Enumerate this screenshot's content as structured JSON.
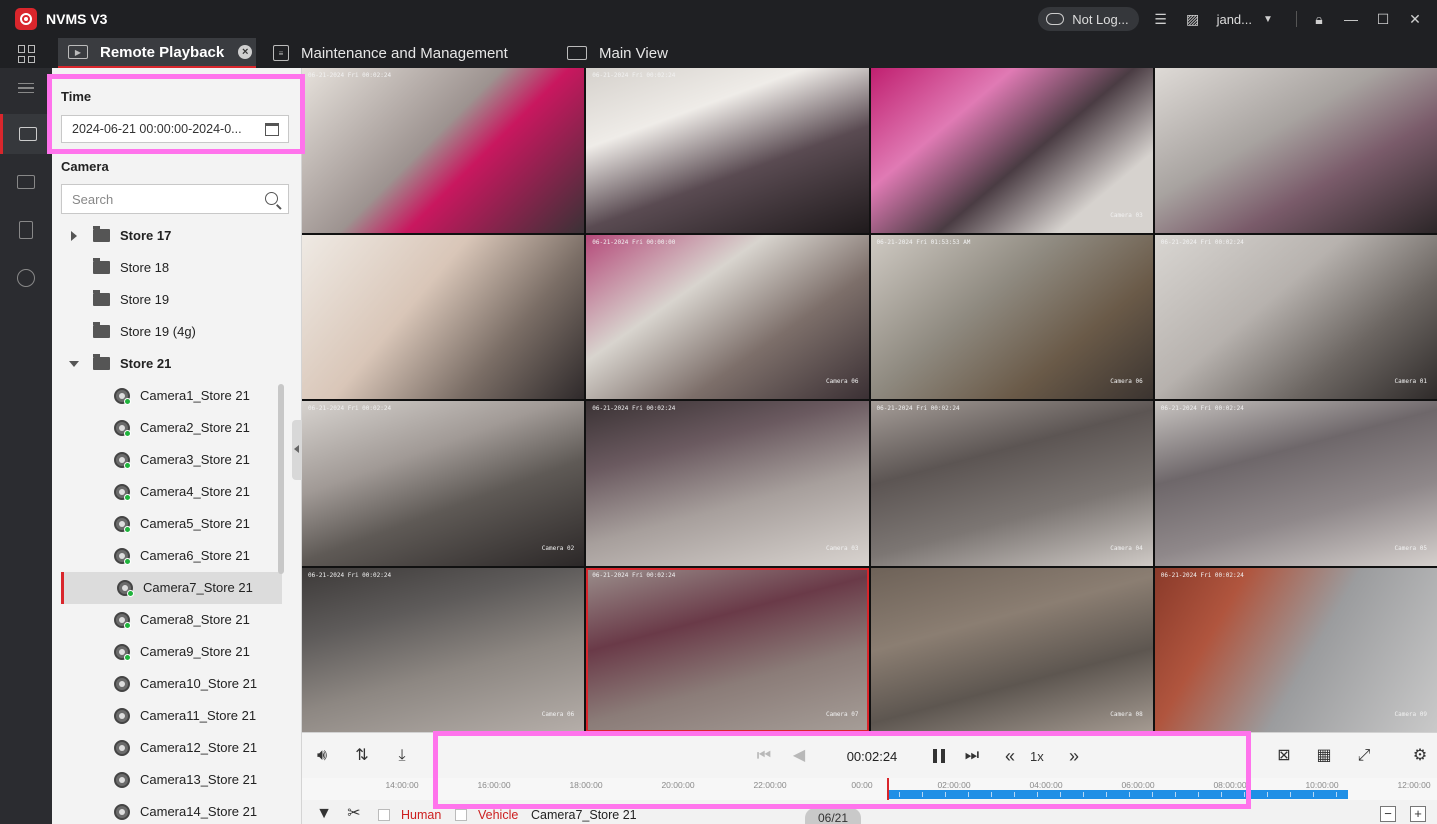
{
  "app": {
    "title": "NVMS V3"
  },
  "titlebar": {
    "login_status": "Not Log...",
    "user": "jand..."
  },
  "tabs": [
    {
      "label": "Remote Playback",
      "active": true,
      "closable": true
    },
    {
      "label": "Maintenance and Management",
      "active": false
    },
    {
      "label": "Main View",
      "active": false
    }
  ],
  "panel": {
    "time_label": "Time",
    "time_value": "2024-06-21 00:00:00-2024-0...",
    "camera_label": "Camera",
    "search_placeholder": "Search",
    "tree": [
      {
        "type": "group",
        "label": "Store 17",
        "state": "collapsed"
      },
      {
        "type": "group",
        "label": "Store 18"
      },
      {
        "type": "group",
        "label": "Store 19"
      },
      {
        "type": "group",
        "label": "Store 19 (4g)"
      },
      {
        "type": "group",
        "label": "Store 21",
        "state": "expanded"
      },
      {
        "type": "camera",
        "label": "Camera1_Store 21",
        "online": true
      },
      {
        "type": "camera",
        "label": "Camera2_Store 21",
        "online": true
      },
      {
        "type": "camera",
        "label": "Camera3_Store 21",
        "online": true
      },
      {
        "type": "camera",
        "label": "Camera4_Store 21",
        "online": true
      },
      {
        "type": "camera",
        "label": "Camera5_Store 21",
        "online": true
      },
      {
        "type": "camera",
        "label": "Camera6_Store 21",
        "online": true
      },
      {
        "type": "camera",
        "label": "Camera7_Store 21",
        "online": true,
        "selected": true
      },
      {
        "type": "camera",
        "label": "Camera8_Store 21",
        "online": true
      },
      {
        "type": "camera",
        "label": "Camera9_Store 21",
        "online": true
      },
      {
        "type": "camera",
        "label": "Camera10_Store 21",
        "online": false
      },
      {
        "type": "camera",
        "label": "Camera11_Store 21",
        "online": false
      },
      {
        "type": "camera",
        "label": "Camera12_Store 21",
        "online": false
      },
      {
        "type": "camera",
        "label": "Camera13_Store 21",
        "online": false
      },
      {
        "type": "camera",
        "label": "Camera14_Store 21",
        "online": false
      }
    ]
  },
  "video_tiles": [
    {
      "stamp": "06-21-2024 Fri 00:02:24",
      "tag": "",
      "style": "t-a"
    },
    {
      "stamp": "06-21-2024 Fri 00:02:24",
      "tag": "",
      "style": "t-b"
    },
    {
      "stamp": "",
      "tag": "Camera 03",
      "style": "t-c"
    },
    {
      "stamp": "",
      "tag": "",
      "style": "t-d"
    },
    {
      "stamp": "",
      "tag": "",
      "style": "t-e"
    },
    {
      "stamp": "06-21-2024 Fri 00:00:00",
      "tag": "Camera 06",
      "style": "t-f"
    },
    {
      "stamp": "06-21-2024 Fri 01:53:53 AM",
      "tag": "Camera 06",
      "style": "t-g"
    },
    {
      "stamp": "06-21-2024 Fri 00:02:24",
      "tag": "Camera 01",
      "style": "t-h"
    },
    {
      "stamp": "06-21-2024 Fri 00:02:24",
      "tag": "Camera 02",
      "style": "t-i"
    },
    {
      "stamp": "06-21-2024 Fri 00:02:24",
      "tag": "Camera 03",
      "style": "t-j"
    },
    {
      "stamp": "06-21-2024 Fri 00:02:24",
      "tag": "Camera 04",
      "style": "t-k"
    },
    {
      "stamp": "06-21-2024 Fri 00:02:24",
      "tag": "Camera 05",
      "style": "t-l"
    },
    {
      "stamp": "06-21-2024 Fri 00:02:24",
      "tag": "Camera 06",
      "style": "t-m"
    },
    {
      "stamp": "06-21-2024 Fri 00:02:24",
      "tag": "Camera 07",
      "style": "t-n",
      "selected": true
    },
    {
      "stamp": "",
      "tag": "Camera 08",
      "style": "t-o"
    },
    {
      "stamp": "06-21-2024 Fri 00:02:24",
      "tag": "Camera 09",
      "style": "t-p"
    }
  ],
  "playback": {
    "current_time": "00:02:24",
    "speed": "1x"
  },
  "timeline": {
    "labels": [
      "14:00:00",
      "16:00:00",
      "18:00:00",
      "20:00:00",
      "22:00:00",
      "00:00",
      "02:00:00",
      "04:00:00",
      "06:00:00",
      "08:00:00",
      "10:00:00",
      "12:00:00"
    ],
    "recording_start_fraction": 0.5,
    "recording_end_fraction": 0.92,
    "cursor_fraction": 0.502
  },
  "filter": {
    "human_label": "Human",
    "vehicle_label": "Vehicle",
    "camera_name": "Camera7_Store 21",
    "date_tab": "06/21"
  },
  "colors": {
    "accent": "#d9262c",
    "recording": "#1f8fe6",
    "online": "#1fb33c",
    "highlight": "#ff73ec",
    "filter_text": "#cc1f1f"
  }
}
